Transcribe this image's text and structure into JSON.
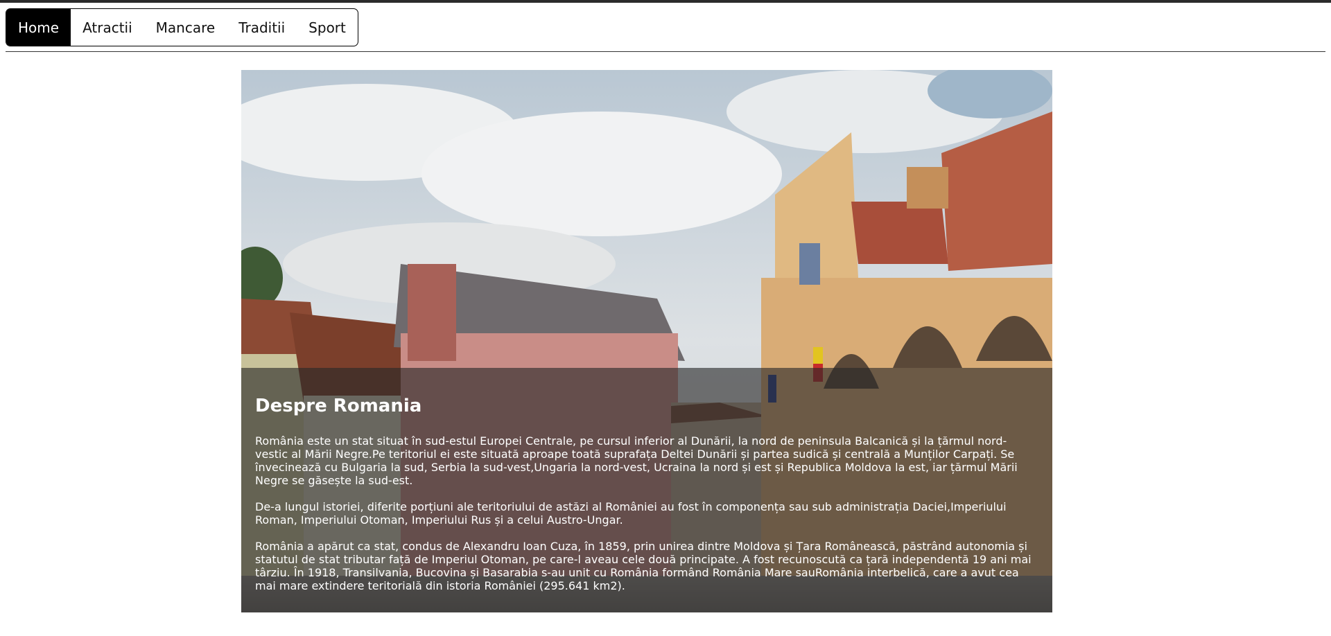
{
  "nav": {
    "items": [
      {
        "label": "Home",
        "active": true
      },
      {
        "label": "Atractii"
      },
      {
        "label": "Mancare"
      },
      {
        "label": "Traditii"
      },
      {
        "label": "Sport"
      }
    ]
  },
  "hero": {
    "image_icon": "photo-of-brasov-council-square",
    "title": "Despre Romania",
    "paragraphs": [
      "România este un stat situat în sud-estul Europei Centrale, pe cursul inferior al Dunării, la nord de peninsula Balcanică și la țărmul nord-vestic al Mării Negre.Pe teritoriul ei este situată aproape toată suprafața Deltei Dunării și partea sudică și centrală a Munților Carpați. Se învecinează cu Bulgaria la sud, Serbia la sud-vest,Ungaria la nord-vest, Ucraina la nord și est și Republica Moldova la est, iar țărmul Mării Negre se găsește la sud-est.",
      "De-a lungul istoriei, diferite porțiuni ale teritoriului de astăzi al României au fost în componența sau sub administrația Daciei,Imperiului Roman, Imperiului Otoman, Imperiului Rus și a celui Austro-Ungar.",
      "România a apărut ca stat, condus de Alexandru Ioan Cuza, în 1859, prin unirea dintre Moldova și Țara Românească, păstrând autonomia și statutul de stat tributar față de Imperiul Otoman, pe care-l aveau cele două principate. A fost recunoscută ca țară independentă 19 ani mai târziu. În 1918, Transilvania, Bucovina și Basarabia s-au unit cu România formând România Mare sauRomânia interbelică, care a avut cea mai mare extindere teritorială din istoria României (295.641 km2)."
    ]
  },
  "colors": {
    "nav_active_bg": "#000000",
    "overlay_bg": "rgba(40,40,40,0.62)"
  }
}
